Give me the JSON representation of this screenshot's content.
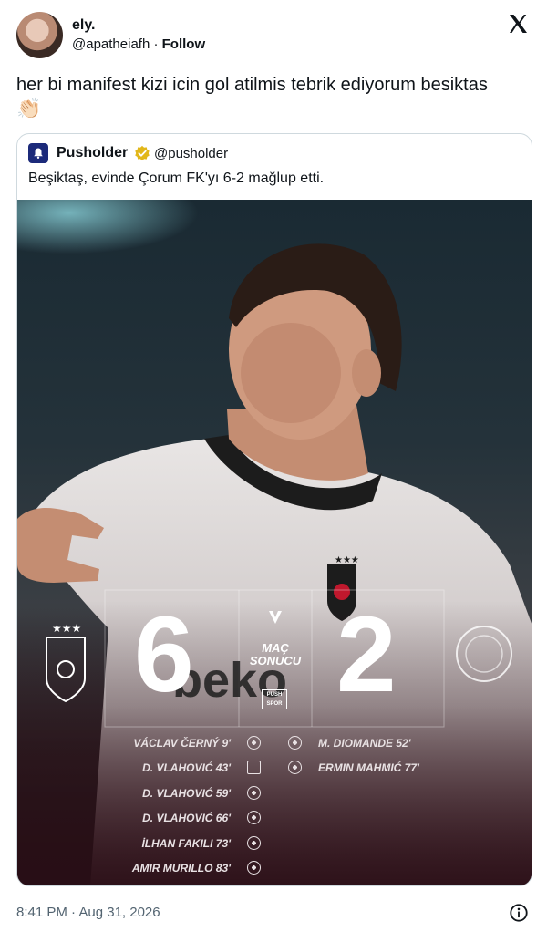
{
  "author": {
    "name": "ely.",
    "handle": "@apatheiafh",
    "separator": " · ",
    "follow_label": "Follow"
  },
  "tweet": {
    "text": "her bi manifest kizi icin gol atilmis tebrik ediyorum besiktas",
    "emoji": "👏🏻"
  },
  "quote": {
    "name": "Pusholder",
    "handle": "@pusholder",
    "text": "Beşiktaş, evinde Çorum FK'yı 6-2 mağlup etti."
  },
  "graphic": {
    "home_score": "6",
    "away_score": "2",
    "result_label_line1": "MAÇ",
    "result_label_line2": "SONUCU",
    "sponsor_top": "PUSH",
    "sponsor_bottom": "SPOR",
    "home_goals": [
      {
        "scorer": "VÁCLAV ČERNÝ",
        "minute": "9'",
        "type": "goal"
      },
      {
        "scorer": "D. VLAHOVIĆ",
        "minute": "43'",
        "type": "penalty"
      },
      {
        "scorer": "D. VLAHOVIĆ",
        "minute": "59'",
        "type": "goal"
      },
      {
        "scorer": "D. VLAHOVIĆ",
        "minute": "66'",
        "type": "goal"
      },
      {
        "scorer": "İLHAN FAKILI",
        "minute": "73'",
        "type": "goal"
      },
      {
        "scorer": "AMIR MURILLO",
        "minute": "83'",
        "type": "goal"
      }
    ],
    "away_goals": [
      {
        "scorer": "M. DIOMANDE",
        "minute": "52'",
        "type": "goal"
      },
      {
        "scorer": "ERMIN MAHMIĆ",
        "minute": "77'",
        "type": "goal"
      }
    ]
  },
  "footer": {
    "timestamp": "8:41 PM · Aug 31, 2026"
  },
  "icons": {
    "brand": "x-logo-icon",
    "verified": "verified-badge-icon",
    "info": "info-icon",
    "goal": "football-icon",
    "penalty": "penalty-goal-icon"
  },
  "colors": {
    "text": "#0f1419",
    "secondary": "#536471",
    "border": "#cfd9de",
    "verified_gold": "#e2b719",
    "pusholder_blue": "#1c2a7a"
  }
}
